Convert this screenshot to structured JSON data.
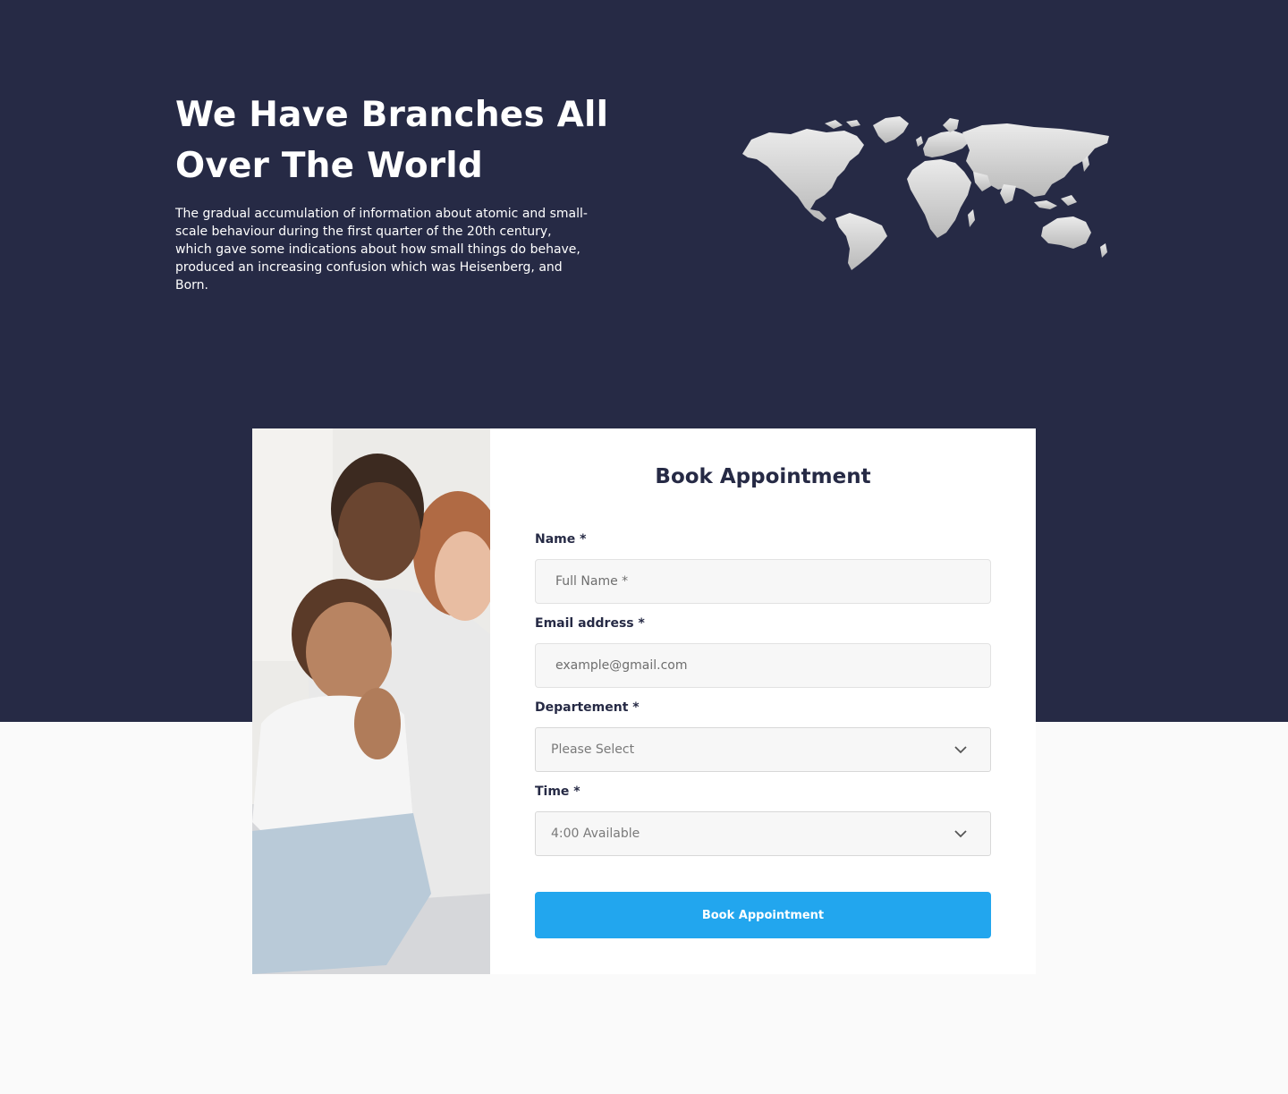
{
  "hero": {
    "title": "We Have Branches All Over The World",
    "text": "The gradual accumulation of information about atomic and small-scale behaviour during the first quarter of the 20th century, which gave some indications about how small things do behave, produced an increasing confusion which was Heisenberg, and Born."
  },
  "appointment": {
    "title": "Book Appointment",
    "name_label": "Name *",
    "name_placeholder": "Full Name *",
    "email_label": "Email address *",
    "email_placeholder": "example@gmail.com",
    "department_label": "Departement *",
    "department_value": "Please Select",
    "time_label": "Time *",
    "time_value": "4:00 Available",
    "submit_label": "Book Appointment"
  },
  "icons": {
    "select_chevron": "chevron-down-icon",
    "map": "world-map-icon"
  },
  "colors": {
    "hero_bg": "#262a45",
    "accent": "#22a6ee",
    "page_bg": "#fafafa"
  }
}
